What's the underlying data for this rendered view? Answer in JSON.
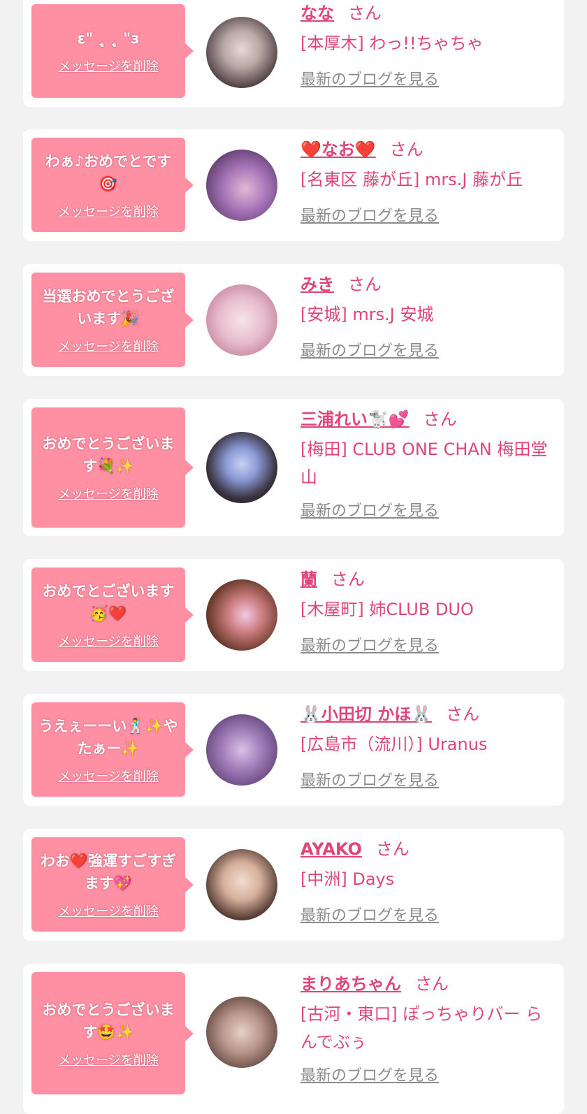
{
  "delete_label": "メッセージを削除",
  "blog_label": "最新のブログを見る",
  "honorific": "さん",
  "colors": {
    "accent": "#e0457a",
    "bubble": "#ff8fa3",
    "link_gray": "#8a8a8a",
    "background": "#f2f2f2"
  },
  "entries": [
    {
      "message": "ε\" ˎ̥ ˎ̥ \"з",
      "name": "なな",
      "shop": "[本厚木] わっ!!ちゃちゃ"
    },
    {
      "message": "わぁ♪おめでとです🎯",
      "name": "❤️なお❤️",
      "shop": "[名東区 藤が丘] mrs.J 藤が丘"
    },
    {
      "message": "当選おめでとうございます🎉",
      "name": "みき",
      "shop": "[安城] mrs.J 安城"
    },
    {
      "message": "おめでとうございます💐✨",
      "name": "三浦れい🐩💕",
      "shop": "[梅田] CLUB ONE CHAN 梅田堂山"
    },
    {
      "message": "おめでとございます🥳❤️",
      "name": "蘭",
      "shop": "[木屋町] 姉CLUB DUO"
    },
    {
      "message": "うえぇーーい🕺✨やたぁー✨",
      "name": "🐰小田切 かほ🐰",
      "shop": "[広島市（流川）] Uranus"
    },
    {
      "message": "わお❤️強運すごすぎます💖",
      "name": "AYAKO",
      "shop": "[中洲] Days"
    },
    {
      "message": "おめでとうございます🤩✨",
      "name": "まりあちゃん",
      "shop": "[古河・東口] ぽっちゃりバー らんでぶぅ"
    }
  ]
}
